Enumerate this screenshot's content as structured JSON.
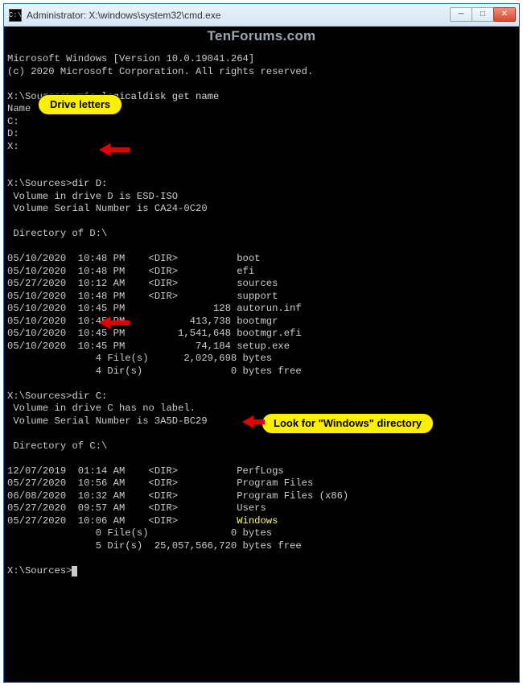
{
  "watermark": "TenForums.com",
  "titlebar": {
    "icon_label": "C:\\",
    "title": "Administrator: X:\\windows\\system32\\cmd.exe",
    "min_symbol": "─",
    "max_symbol": "□",
    "close_symbol": "✕"
  },
  "callouts": {
    "drive_letters": "Drive letters",
    "look_windows": "Look for \"Windows\" directory"
  },
  "lines": {
    "l1": "Microsoft Windows [Version 10.0.19041.264]",
    "l2": "(c) 2020 Microsoft Corporation. All rights reserved.",
    "blank": " ",
    "p1_prompt": "X:\\Sources>",
    "p1_cmd": "wmic logicaldisk get name",
    "name_header": "Name",
    "drv_c": "C:",
    "drv_d": "D:",
    "drv_x": "X:",
    "p2_prompt": "X:\\Sources>",
    "p2_cmd": "dir D:",
    "d_vol": " Volume in drive D is ESD-ISO",
    "d_ser": " Volume Serial Number is CA24-0C20",
    "d_dirof": " Directory of D:\\",
    "d_r1": "05/10/2020  10:48 PM    <DIR>          boot",
    "d_r2": "05/10/2020  10:48 PM    <DIR>          efi",
    "d_r3": "05/27/2020  10:12 AM    <DIR>          sources",
    "d_r4": "05/10/2020  10:48 PM    <DIR>          support",
    "d_r5": "05/10/2020  10:45 PM               128 autorun.inf",
    "d_r6": "05/10/2020  10:45 PM           413,738 bootmgr",
    "d_r7": "05/10/2020  10:45 PM         1,541,648 bootmgr.efi",
    "d_r8": "05/10/2020  10:45 PM            74,184 setup.exe",
    "d_f": "               4 File(s)      2,029,698 bytes",
    "d_d": "               4 Dir(s)               0 bytes free",
    "p3_prompt": "X:\\Sources>",
    "p3_cmd": "dir C:",
    "c_vol": " Volume in drive C has no label.",
    "c_ser": " Volume Serial Number is 3A5D-BC29",
    "c_dirof": " Directory of C:\\",
    "c_r1": "12/07/2019  01:14 AM    <DIR>          PerfLogs",
    "c_r2": "05/27/2020  10:56 AM    <DIR>          Program Files",
    "c_r3": "06/08/2020  10:32 AM    <DIR>          Program Files (x86)",
    "c_r4": "05/27/2020  09:57 AM    <DIR>          Users",
    "c_r5a": "05/27/2020  10:06 AM    <DIR>          ",
    "c_r5b": "Windows",
    "c_f": "               0 File(s)              0 bytes",
    "c_d": "               5 Dir(s)  25,057,566,720 bytes free",
    "p4_prompt": "X:\\Sources>"
  }
}
